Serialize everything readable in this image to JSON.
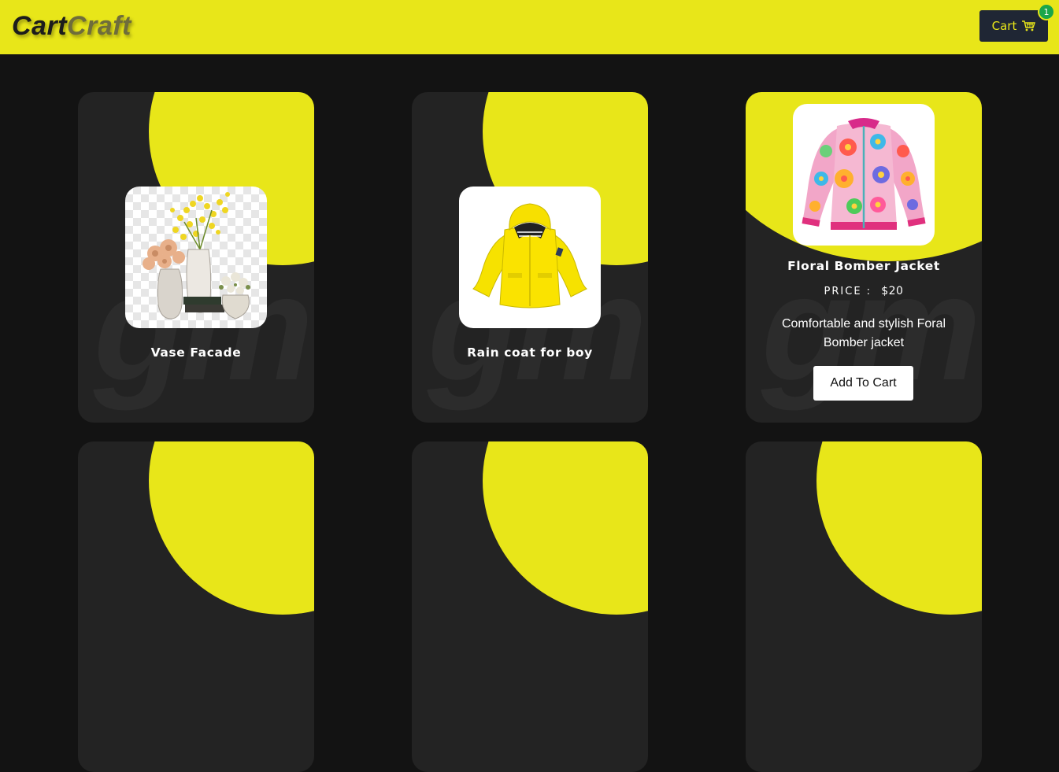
{
  "brand": {
    "part1": "Cart",
    "part2": "Craft"
  },
  "cart": {
    "label": "Cart",
    "count": "1"
  },
  "colors": {
    "accent": "#e8e619",
    "background": "#131313",
    "card": "#232323",
    "badge": "#1aa64a",
    "cart_button": "#1f2634"
  },
  "products": [
    {
      "name": "Vase Facade",
      "icon": "vase-image"
    },
    {
      "name": "Rain coat for boy",
      "icon": "raincoat-image"
    },
    {
      "name": "Floral Bomber Jacket",
      "icon": "jacket-image",
      "price_label": "PRICE :",
      "price": "$20",
      "description": "Comfortable and stylish Foral Bomber jacket",
      "button_label": "Add To Cart"
    }
  ],
  "watermark": "gm"
}
